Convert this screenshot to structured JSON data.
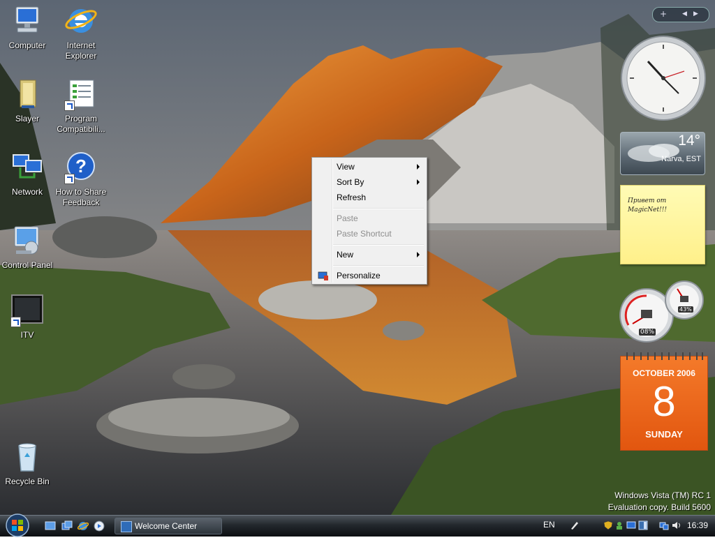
{
  "desktop": {
    "icons": [
      {
        "label": "Computer",
        "icon": "computer-icon"
      },
      {
        "label": "Internet Explorer",
        "icon": "internet-explorer-icon"
      },
      {
        "label": "Slayer",
        "icon": "folder-icon"
      },
      {
        "label": "Program Compatibili...",
        "icon": "program-compatibility-icon"
      },
      {
        "label": "Network",
        "icon": "network-icon"
      },
      {
        "label": "How to Share Feedback",
        "icon": "help-icon"
      },
      {
        "label": "Control Panel",
        "icon": "control-panel-icon"
      },
      {
        "label": "ITV",
        "icon": "tv-icon"
      },
      {
        "label": "Recycle Bin",
        "icon": "recycle-bin-icon"
      }
    ]
  },
  "context_menu": {
    "items": [
      {
        "label": "View",
        "submenu": true,
        "disabled": false
      },
      {
        "label": "Sort By",
        "submenu": true,
        "disabled": false
      },
      {
        "label": "Refresh",
        "submenu": false,
        "disabled": false
      },
      {
        "label": "Paste",
        "submenu": false,
        "disabled": true
      },
      {
        "label": "Paste Shortcut",
        "submenu": false,
        "disabled": true
      },
      {
        "label": "New",
        "submenu": true,
        "disabled": false
      },
      {
        "label": "Personalize",
        "submenu": false,
        "disabled": false,
        "icon": "personalize-icon"
      }
    ]
  },
  "sidebar": {
    "controls": [
      "+",
      "◀",
      "▶"
    ],
    "weather": {
      "temperature": "14°",
      "location": "Narva, EST"
    },
    "notes": {
      "text": "Привет от MagicNet!!!"
    },
    "cpu_meter": {
      "cpu": "08%",
      "memory": "43%"
    },
    "calendar": {
      "month": "OCTOBER 2006",
      "day": "8",
      "weekday": "SUNDAY"
    }
  },
  "watermark": {
    "line1": "Windows Vista (TM) RC 1",
    "line2": "Evaluation copy. Build 5600"
  },
  "taskbar": {
    "quick_launch": [
      "show-desktop-icon",
      "switch-windows-icon",
      "internet-explorer-icon",
      "media-player-icon"
    ],
    "tasks": [
      {
        "label": "Welcome Center"
      }
    ],
    "language": "EN",
    "clock": "16:39"
  },
  "colors": {
    "calendar_orange": "#e8601a",
    "note_yellow": "#fff6a0",
    "taskbar_dark": "#1a1e22"
  }
}
